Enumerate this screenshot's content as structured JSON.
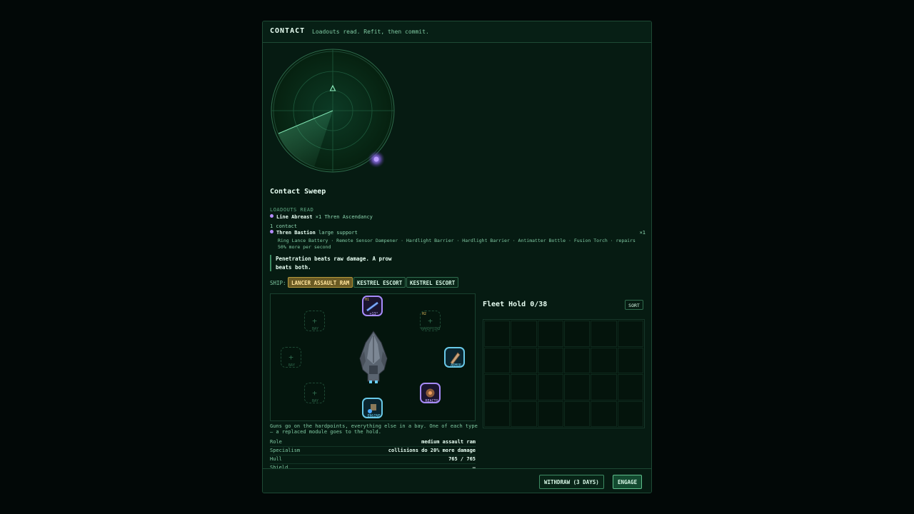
{
  "header": {
    "title": "CONTACT",
    "subtitle": "Loadouts read. Refit, then commit."
  },
  "sweep": {
    "title": "Contact Sweep",
    "loadouts_label": "LOADOUTS READ",
    "formation_name": "Line Abreast",
    "formation_detail": "×1 Thren Ascendancy",
    "contact_count": "1 contact",
    "contact_name": "Thren Bastion",
    "contact_class": "large support",
    "contact_multiplier": "×1",
    "contact_loadout": "Ring Lance Battery · Remote Sensor Dampener · Hardlight Barrier · Hardlight Barrier · Antimatter Bottle · Fusion Torch · repairs 50% more per second",
    "tip": "Penetration beats raw damage. A prow beats both."
  },
  "ship_select": {
    "label": "SHIP:",
    "ships": [
      "LANCER ASSAULT RAM",
      "KESTREL ESCORT",
      "KESTREL ESCORT"
    ],
    "selected_index": 0
  },
  "fitting": {
    "slots": {
      "h1": {
        "tag": "H1",
        "label": "+13°"
      },
      "h2": {
        "tag": "H2",
        "label": "HARDPOINT",
        "plus": "+"
      },
      "bay_tl": {
        "label": "BAY",
        "plus": "+"
      },
      "bay_l": {
        "label": "BAY",
        "plus": "+"
      },
      "bay_bl": {
        "label": "BAY",
        "plus": "+"
      },
      "armor": {
        "label": "ARMOR"
      },
      "reactor": {
        "label": "REACTO"
      },
      "engine": {
        "label": "ENGINE"
      }
    },
    "help": "Guns go on the hardpoints, everything else in a bay. One of each type — a replaced module goes to the hold."
  },
  "stats": [
    {
      "key": "Role",
      "value": "medium assault ram"
    },
    {
      "key": "Specialism",
      "value": "collisions do 20% more damage"
    },
    {
      "key": "Hull",
      "value": "765 / 765"
    },
    {
      "key": "Shield",
      "value": "–"
    }
  ],
  "hold": {
    "title": "Fleet Hold 0/38",
    "sort_label": "SORT",
    "used": 0,
    "capacity": 38
  },
  "footer": {
    "withdraw_label": "WITHDRAW (3 DAYS)",
    "engage_label": "ENGAGE"
  },
  "colors": {
    "accent": "#8fd9b3",
    "selected": "#b59a3d",
    "module_blue": "#69c9e8",
    "module_purple": "#a78bfa"
  }
}
